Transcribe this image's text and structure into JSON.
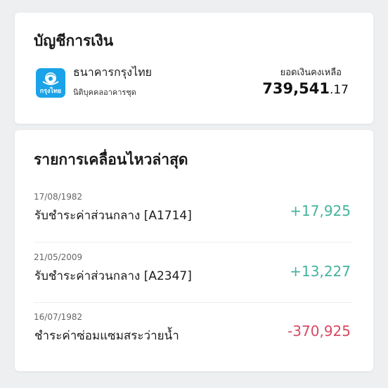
{
  "account_section": {
    "title": "บัญชีการเงิน",
    "bank_name": "ธนาคารกรุงไทย",
    "bank_logo_text": "กรุงไทย",
    "account_name": "นิติบุคคลอาคารชุด",
    "balance_label": "ยอดเงินคงเหลือ",
    "balance_integer": "739,541",
    "balance_decimal": ".17"
  },
  "transactions_section": {
    "title": "รายการเคลื่อนไหวล่าสุด",
    "items": [
      {
        "date": "17/08/1982",
        "description": "รับชำระค่าส่วนกลาง [A1714]",
        "amount": "+17,925",
        "type": "credit"
      },
      {
        "date": "21/05/2009",
        "description": "รับชำระค่าส่วนกลาง [A2347]",
        "amount": "+13,227",
        "type": "credit"
      },
      {
        "date": "16/07/1982",
        "description": "ชำระค่าซ่อมแซมสระว่ายน้ำ",
        "amount": "-370,925",
        "type": "debit"
      }
    ]
  },
  "colors": {
    "background": "#eeeff1",
    "card": "#ffffff",
    "credit": "#45b39e",
    "debit": "#d64b63",
    "bank_brand": "#1aa3e8"
  },
  "icons": {
    "bank_logo": "krungthai-bird-logo"
  }
}
